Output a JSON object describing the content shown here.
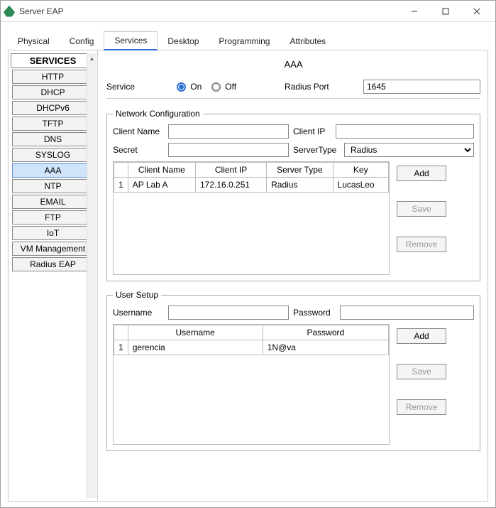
{
  "window": {
    "title": "Server EAP",
    "background_hint": ""
  },
  "tabs": [
    "Physical",
    "Config",
    "Services",
    "Desktop",
    "Programming",
    "Attributes"
  ],
  "active_tab": "Services",
  "sidebar": {
    "header": "SERVICES",
    "items": [
      "HTTP",
      "DHCP",
      "DHCPv6",
      "TFTP",
      "DNS",
      "SYSLOG",
      "AAA",
      "NTP",
      "EMAIL",
      "FTP",
      "IoT",
      "VM Management",
      "Radius EAP"
    ],
    "selected": "AAA"
  },
  "panel": {
    "title": "AAA",
    "service_label": "Service",
    "on_label": "On",
    "off_label": "Off",
    "service_on": true,
    "radius_port_label": "Radius Port",
    "radius_port": "1645",
    "network_conf": {
      "legend": "Network Configuration",
      "client_name_label": "Client Name",
      "client_name": "",
      "client_ip_label": "Client IP",
      "client_ip": "",
      "secret_label": "Secret",
      "secret": "",
      "server_type_label": "ServerType",
      "server_type": "Radius",
      "columns": [
        "Client Name",
        "Client IP",
        "Server Type",
        "Key"
      ],
      "rows": [
        {
          "n": "1",
          "client_name": "AP Lab A",
          "client_ip": "172.16.0.251",
          "server_type": "Radius",
          "key": "LucasLeo"
        }
      ]
    },
    "user_setup": {
      "legend": "User Setup",
      "username_label": "Username",
      "username": "",
      "password_label": "Password",
      "password": "",
      "columns": [
        "Username",
        "Password"
      ],
      "rows": [
        {
          "n": "1",
          "username": "gerencia",
          "password": "1N@va"
        }
      ]
    },
    "buttons": {
      "add": "Add",
      "save": "Save",
      "remove": "Remove"
    }
  },
  "window_controls": {
    "min": "minimize",
    "max": "maximize",
    "close": "close"
  }
}
